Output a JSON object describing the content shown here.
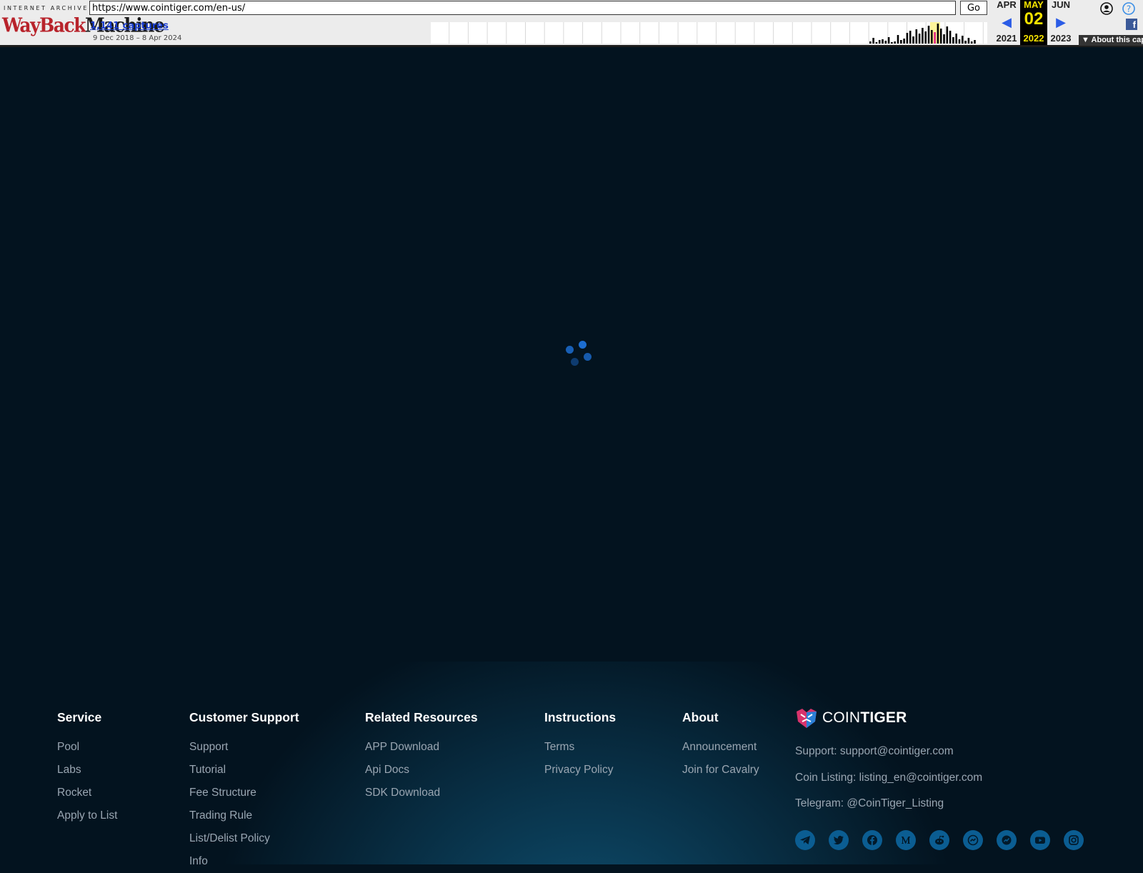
{
  "wayback": {
    "logo_top": "INTERNET ARCHIVE",
    "logo_word1": "WayBack",
    "logo_word2": "Machine",
    "url": "https://www.cointiger.com/en-us/",
    "go_label": "Go",
    "captures_label": "1,141 captures",
    "date_range": "9 Dec 2018 – 8 Apr 2024",
    "calendar": {
      "prev_month": "APR",
      "cur_month": "MAY",
      "next_month": "JUN",
      "day": "02",
      "prev_year": "2021",
      "cur_year": "2022",
      "next_year": "2023"
    },
    "about_label": "▼ About this capture",
    "icons": {
      "user": "user-icon",
      "help": "help-icon",
      "facebook": "facebook-icon",
      "prev": "prev-arrow-icon",
      "next": "next-arrow-icon"
    }
  },
  "loader": {
    "icon": "loading-spinner-icon",
    "color": "#1c6dd0"
  },
  "footer": {
    "columns": [
      {
        "title": "Service",
        "items": [
          "Pool",
          "Labs",
          "Rocket",
          "Apply to List"
        ]
      },
      {
        "title": "Customer Support",
        "items": [
          "Support",
          "Tutorial",
          "Fee Structure",
          "Trading Rule",
          "List/Delist Policy",
          "Info"
        ]
      },
      {
        "title": "Related Resources",
        "items": [
          "APP Download",
          "Api Docs",
          "SDK Download"
        ]
      },
      {
        "title": "Instructions",
        "items": [
          "Terms",
          "Privacy Policy"
        ]
      },
      {
        "title": "About",
        "items": [
          "Announcement",
          "Join for Cavalry"
        ]
      }
    ],
    "brand": {
      "name_light": "COIN",
      "name_bold": "TIGER"
    },
    "contacts": [
      "Support: support@cointiger.com",
      "Coin Listing: listing_en@cointiger.com",
      "Telegram: @CoinTiger_Listing"
    ],
    "socials": [
      "telegram-icon",
      "twitter-icon",
      "facebook-icon",
      "medium-icon",
      "reddit-icon",
      "messenger-icon",
      "coinmarketcap-icon",
      "youtube-icon",
      "instagram-icon"
    ]
  },
  "colors": {
    "page_bg": "#03131f",
    "accent": "#0b5d92",
    "link_text": "#9aa6b2"
  }
}
